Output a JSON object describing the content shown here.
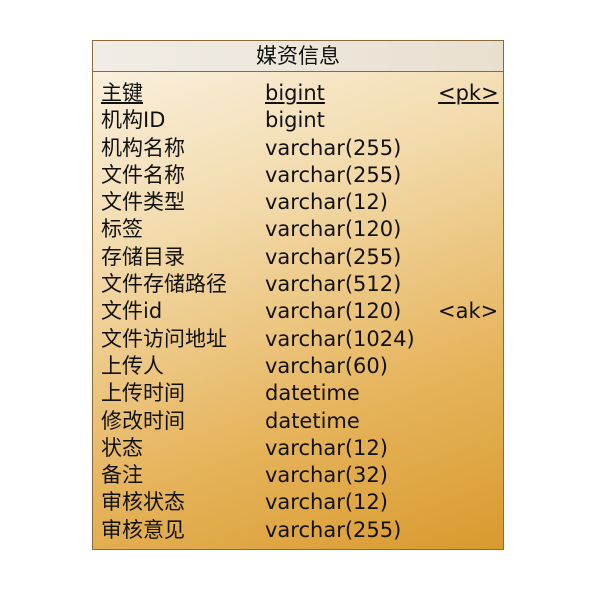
{
  "entity": {
    "title": "媒资信息",
    "columns": [
      {
        "name": "主键",
        "type": "bigint",
        "key": "<pk>",
        "primary": true
      },
      {
        "name": "机构ID",
        "type": "bigint",
        "key": ""
      },
      {
        "name": "机构名称",
        "type": "varchar(255)",
        "key": ""
      },
      {
        "name": "文件名称",
        "type": "varchar(255)",
        "key": ""
      },
      {
        "name": "文件类型",
        "type": "varchar(12)",
        "key": ""
      },
      {
        "name": "标签",
        "type": "varchar(120)",
        "key": ""
      },
      {
        "name": "存储目录",
        "type": "varchar(255)",
        "key": ""
      },
      {
        "name": "文件存储路径",
        "type": "varchar(512)",
        "key": ""
      },
      {
        "name": "文件id",
        "type": "varchar(120)",
        "key": "<ak>"
      },
      {
        "name": "文件访问地址",
        "type": "varchar(1024)",
        "key": ""
      },
      {
        "name": "上传人",
        "type": "varchar(60)",
        "key": ""
      },
      {
        "name": "上传时间",
        "type": "datetime",
        "key": ""
      },
      {
        "name": "修改时间",
        "type": "datetime",
        "key": ""
      },
      {
        "name": "状态",
        "type": "varchar(12)",
        "key": ""
      },
      {
        "name": "备注",
        "type": "varchar(32)",
        "key": ""
      },
      {
        "name": "审核状态",
        "type": "varchar(12)",
        "key": ""
      },
      {
        "name": "审核意见",
        "type": "varchar(255)",
        "key": ""
      }
    ]
  },
  "colors": {
    "border": "#8a6a3a",
    "header_bg": "#ece6db",
    "gradient_start": "#fbf3e6",
    "gradient_end": "#d99a2e"
  }
}
